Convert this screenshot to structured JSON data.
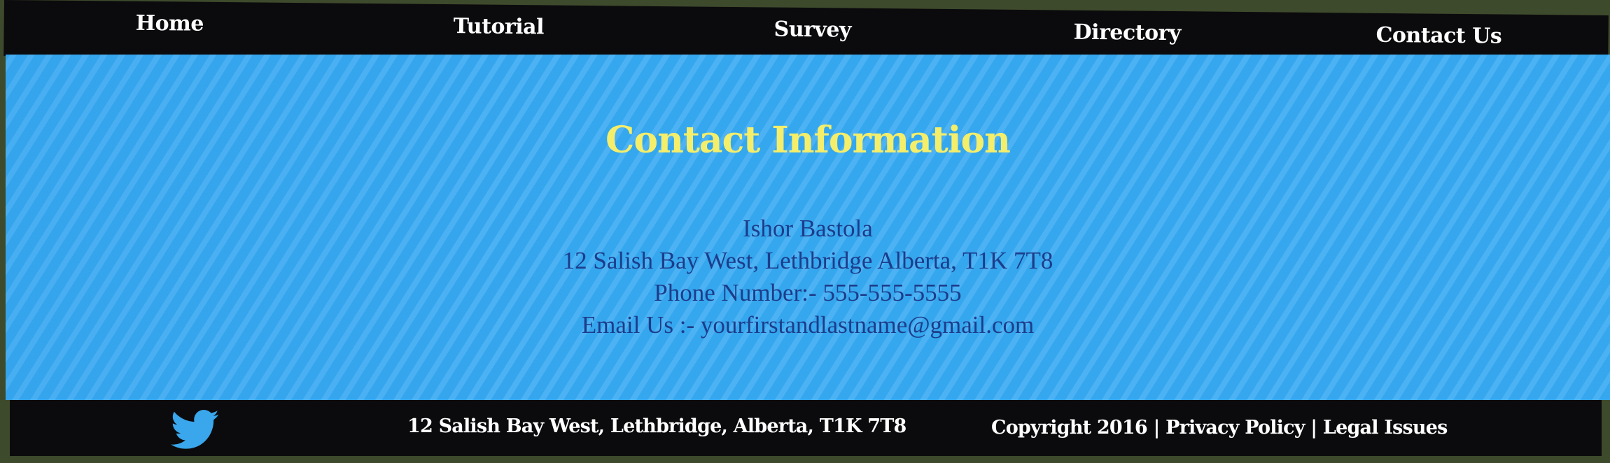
{
  "nav": {
    "items": [
      {
        "label": "Home"
      },
      {
        "label": "Tutorial"
      },
      {
        "label": "Survey"
      },
      {
        "label": "Directory"
      },
      {
        "label": "Contact Us"
      }
    ]
  },
  "main": {
    "title": "Contact Information",
    "contact": {
      "name": "Ishor Bastola",
      "address": "12 Salish Bay West, Lethbridge Alberta, T1K 7T8",
      "phone": "Phone Number:- 555-555-5555",
      "email": "Email Us :- yourfirstandlastname@gmail.com"
    }
  },
  "footer": {
    "icon": "twitter-icon",
    "address": "12 Salish Bay West, Lethbridge, Alberta, T1K 7T8",
    "copyright": "Copyright 2016",
    "separator": "|",
    "privacy": "Privacy Policy",
    "legal": "Legal Issues"
  },
  "colors": {
    "bar": "#0b0b0d",
    "content_bg": "#35a7ee",
    "title": "#f5ee6a",
    "contact_text": "#1d3c8a",
    "twitter": "#3aa6ec"
  }
}
